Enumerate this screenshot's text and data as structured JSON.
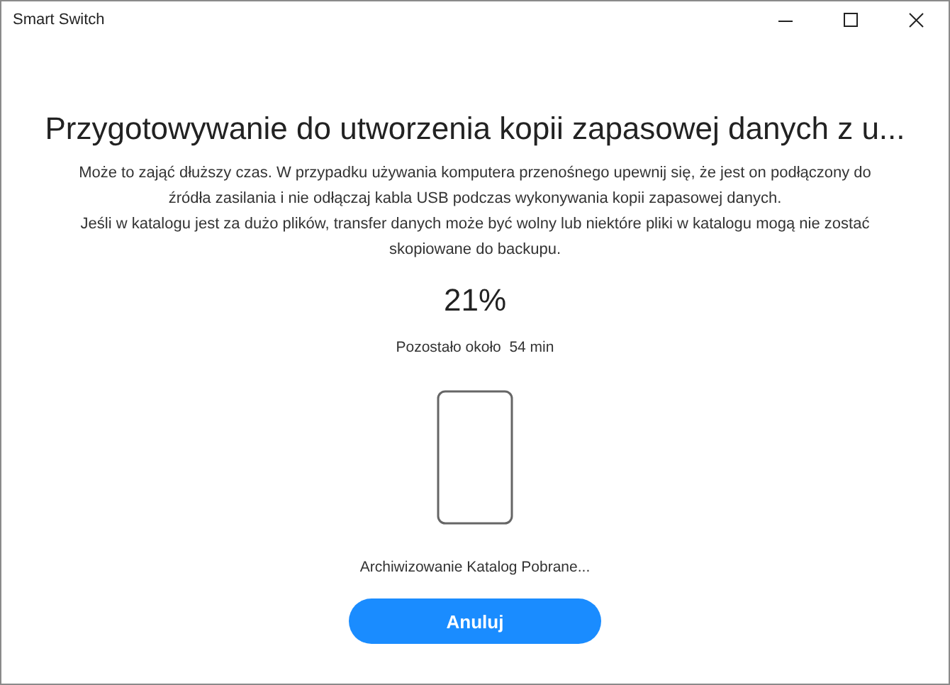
{
  "window": {
    "title": "Smart Switch"
  },
  "heading": "Przygotowywanie do utworzenia kopii zapasowej danych z u...",
  "description": [
    "Może to zająć dłuższy czas. W przypadku używania komputera przenośnego upewnij się, że jest on podłączony do źródła zasilania i nie odłączaj kabla USB podczas wykonywania kopii zapasowej danych.",
    "Jeśli w katalogu jest za dużo plików, transfer danych może być wolny lub niektóre pliki w katalogu mogą nie zostać skopiowane do backupu."
  ],
  "percent": "21%",
  "remaining": "Pozostało około  54 min",
  "status": "Archiwizowanie Katalog Pobrane...",
  "button": "Anuluj"
}
